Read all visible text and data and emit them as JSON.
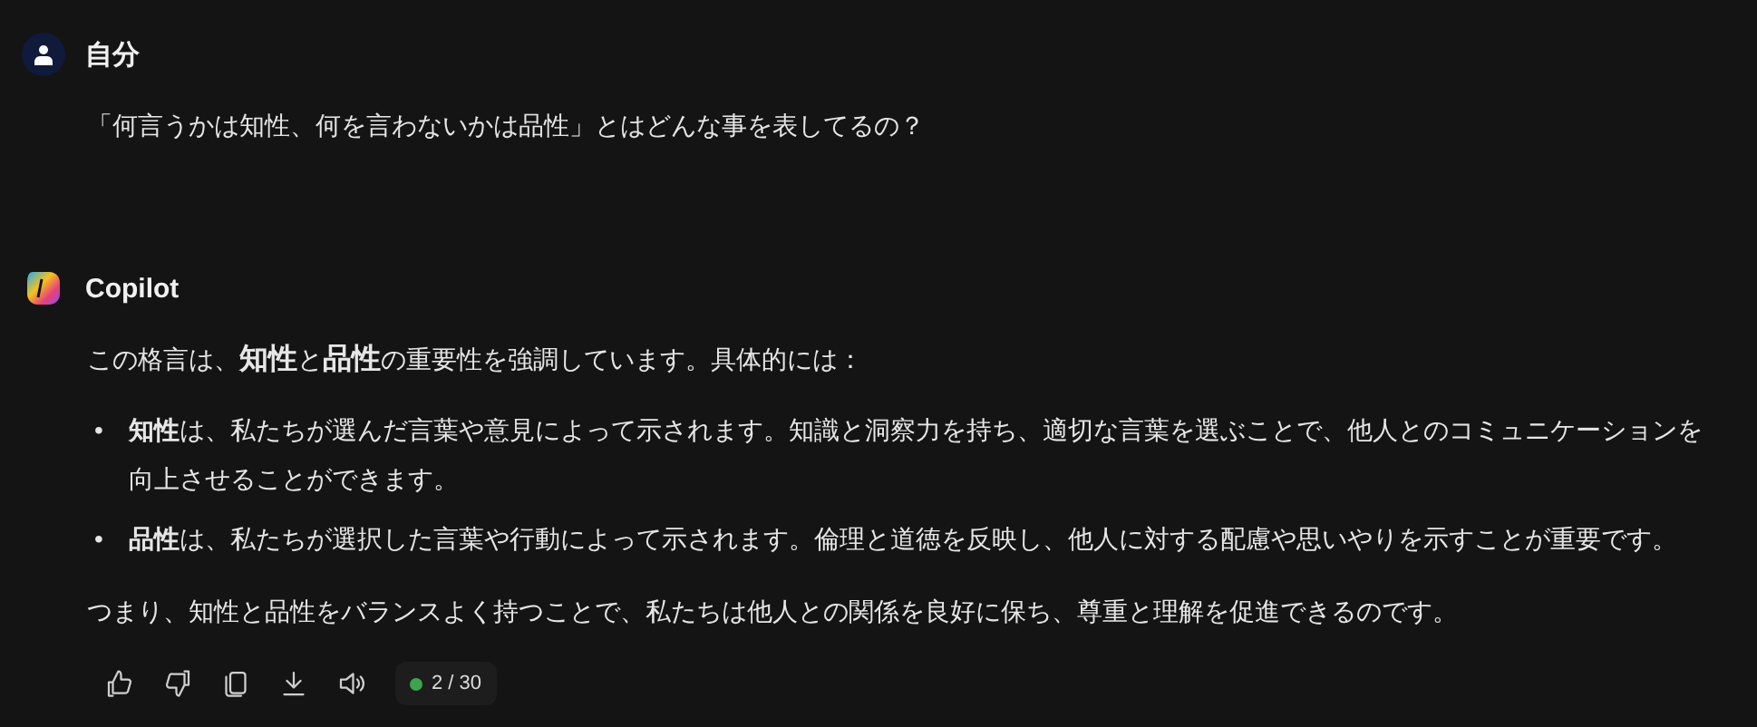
{
  "user": {
    "name": "自分",
    "message": "「何言うかは知性、何を言わないかは品性」とはどんな事を表してるの？"
  },
  "assistant": {
    "name": "Copilot",
    "intro": "この格言は、**知性**と**品性**の重要性を強調しています。具体的には：",
    "bullets": [
      {
        "marker": "•",
        "text": "**知性**は、私たちが選んだ言葉や意見によって示されます。知識と洞察力を持ち、適切な言葉を選ぶことで、他人とのコミュニケーションを向上させることができます。"
      },
      {
        "marker": "•",
        "text": "**品性**は、私たちが選択した言葉や行動によって示されます。倫理と道徳を反映し、他人に対する配慮や思いやりを示すことが重要です。"
      }
    ],
    "conclusion": "つまり、知性と品性をバランスよく持つことで、私たちは他人との関係を良好に保ち、尊重と理解を促進できるのです。",
    "counter": "2 / 30"
  }
}
